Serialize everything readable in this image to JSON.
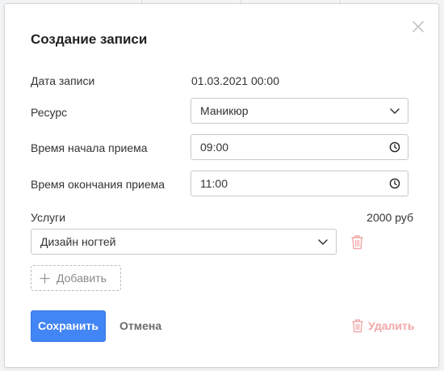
{
  "dialog": {
    "title": "Создание записи",
    "close_icon": "close-icon"
  },
  "form": {
    "date_label": "Дата записи",
    "date_value": "01.03.2021 00:00",
    "resource_label": "Ресурс",
    "resource_value": "Маникюр",
    "start_label": "Время начала приема",
    "start_value": "09:00",
    "end_label": "Время окончания приема",
    "end_value": "11:00"
  },
  "services": {
    "label": "Услуги",
    "total": "2000 руб",
    "items": [
      {
        "name": "Дизайн ногтей"
      }
    ],
    "add_label": "Добавить"
  },
  "actions": {
    "save_label": "Сохранить",
    "cancel_label": "Отмена",
    "delete_label": "Удалить"
  },
  "colors": {
    "primary": "#4285f4",
    "danger_light": "#f2a6a6"
  }
}
